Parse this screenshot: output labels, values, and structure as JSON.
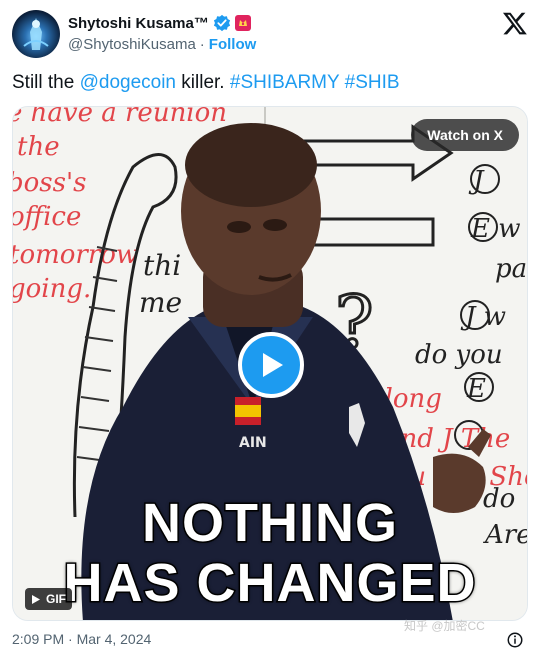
{
  "author": {
    "display_name": "Shytoshi Kusama™",
    "handle": "@ShytoshiKusama",
    "separator": "·",
    "follow_label": "Follow"
  },
  "tweet": {
    "text_prefix": "Still the ",
    "mention": "@dogecoin",
    "text_mid": " killer. ",
    "hashtag1": "#SHIBARMY",
    "hashtag2": "#SHIB"
  },
  "media": {
    "caption_line1": "NOTHING",
    "caption_line2": "HAS CHANGED",
    "watch_label": "Watch on X",
    "badge_label": "GIF",
    "whiteboard_left": [
      "e have a reunion",
      "the",
      "boss's",
      "office",
      "tomorrow",
      "going."
    ],
    "whiteboard_mid": [
      "thi",
      "me"
    ],
    "whiteboard_right": [
      "J",
      "E w",
      "pa",
      "J w",
      "do you",
      "E",
      "along",
      "and J The",
      "you can Shou",
      "do",
      "Are"
    ],
    "shirt_text": "AIN"
  },
  "footer": {
    "timestamp": "2:09 PM · Mar 4, 2024",
    "watermark": "知乎 @加密CC"
  },
  "colors": {
    "accent": "#1d9bf0",
    "text": "#0f1419",
    "secondary": "#536471"
  },
  "icons": {
    "verified": "verified-badge-icon",
    "affiliate": "affiliate-badge-icon",
    "x_logo": "x-logo-icon",
    "play": "play-icon",
    "info": "info-icon"
  }
}
